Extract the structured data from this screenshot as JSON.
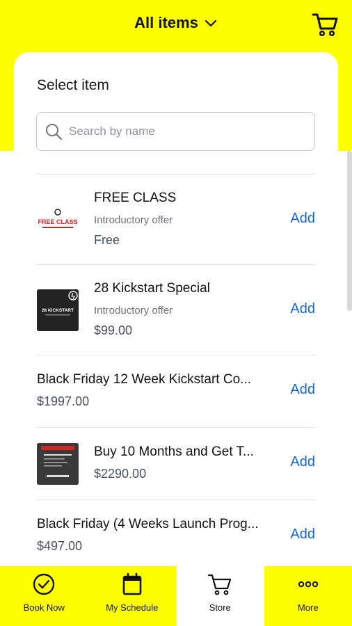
{
  "header": {
    "title": "All items"
  },
  "sheet": {
    "title": "Select item",
    "search_placeholder": "Search by name"
  },
  "items": [
    {
      "name": "FREE CLASS",
      "subtitle": "Introductory offer",
      "price": "Free",
      "add_label": "Add",
      "thumb_text": "FREE CLASS"
    },
    {
      "name": "28 Kickstart Special",
      "subtitle": "Introductory offer",
      "price": "$99.00",
      "add_label": "Add",
      "thumb_text": "28 KICKSTART"
    },
    {
      "name": "Black Friday 12 Week Kickstart Co...",
      "price": "$1997.00",
      "add_label": "Add"
    },
    {
      "name": "Buy 10 Months and Get T...",
      "price": "$2290.00",
      "add_label": "Add"
    },
    {
      "name": "Black Friday (4 Weeks Launch Prog...",
      "price": "$497.00",
      "add_label": "Add"
    }
  ],
  "tabs": [
    {
      "label": "Book Now",
      "icon": "check-circle-icon"
    },
    {
      "label": "My Schedule",
      "icon": "calendar-icon"
    },
    {
      "label": "Store",
      "icon": "cart-icon",
      "active": true
    },
    {
      "label": "More",
      "icon": "more-dots-icon"
    }
  ],
  "colors": {
    "accent_yellow": "#ffff00",
    "link_blue": "#1565d8"
  }
}
